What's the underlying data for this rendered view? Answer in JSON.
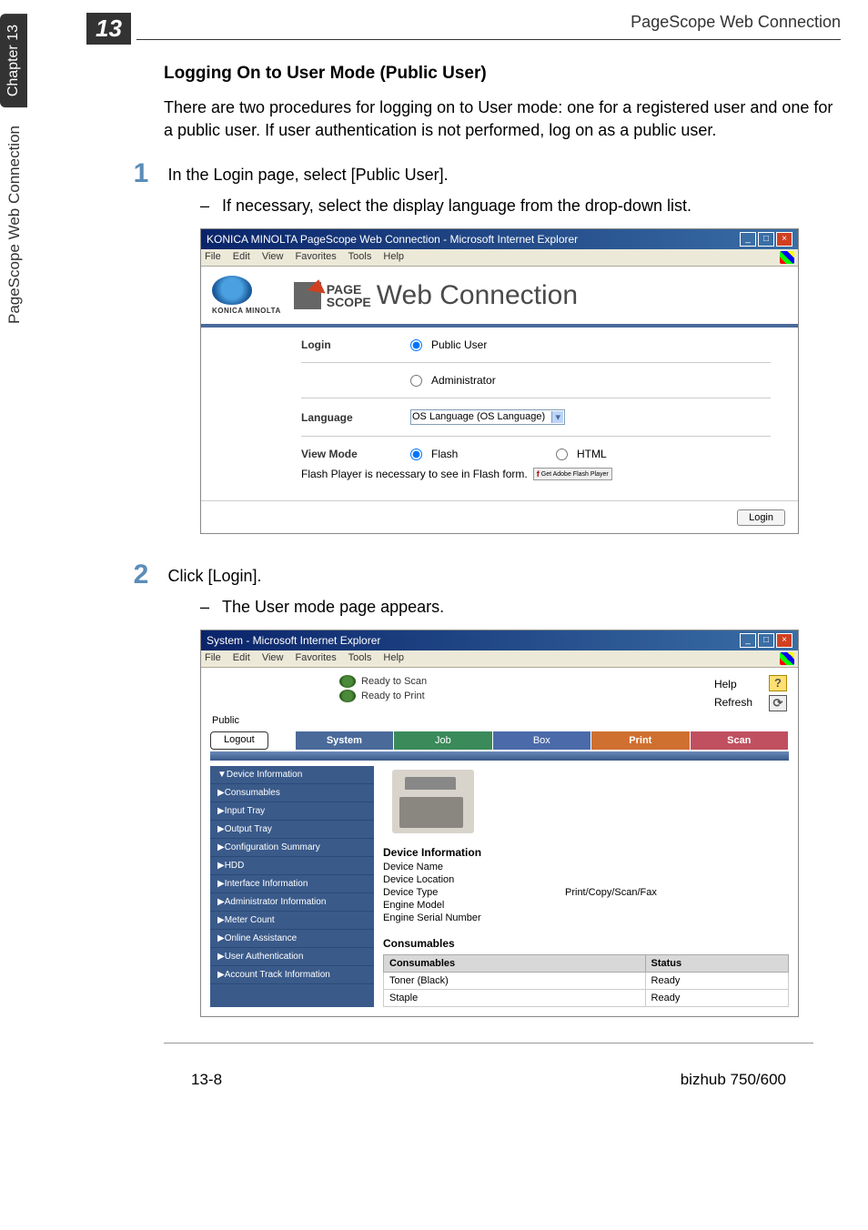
{
  "sidebar": {
    "chapter_tab": "Chapter 13",
    "side_text": "PageScope Web Connection"
  },
  "chapter_num": "13",
  "header_title": "PageScope Web Connection",
  "section_title": "Logging On to User Mode (Public User)",
  "intro_text": "There are two procedures for logging on to User mode:\none for a registered user and one for a public user. If user authentication is not performed, log on as a public user.",
  "steps": [
    {
      "num": "1",
      "text": "In the Login page, select [Public User].",
      "sub": "If necessary, select the display language from the drop-down list."
    },
    {
      "num": "2",
      "text": "Click [Login].",
      "sub": "The User mode page appears."
    }
  ],
  "login_shot": {
    "title": "KONICA MINOLTA PageScope Web Connection - Microsoft Internet Explorer",
    "menus": [
      "File",
      "Edit",
      "View",
      "Favorites",
      "Tools",
      "Help"
    ],
    "logo_brand": "KONICA MINOLTA",
    "ps_page": "PAGE",
    "ps_scope": "SCOPE",
    "ps_main": "Web Connection",
    "rows": {
      "login_label": "Login",
      "public_user": "Public User",
      "administrator": "Administrator",
      "language_label": "Language",
      "language_value": "OS Language (OS Language)",
      "viewmode_label": "View Mode",
      "flash": "Flash",
      "html": "HTML",
      "flash_note": "Flash Player is necessary to see in Flash form.",
      "flash_badge": "Get Adobe Flash Player"
    },
    "login_button": "Login"
  },
  "system_shot": {
    "title": "System - Microsoft Internet Explorer",
    "menus": [
      "File",
      "Edit",
      "View",
      "Favorites",
      "Tools",
      "Help"
    ],
    "status": {
      "scan": "Ready to Scan",
      "print": "Ready to Print"
    },
    "help": "Help",
    "refresh": "Refresh",
    "public": "Public",
    "logout": "Logout",
    "tabs": {
      "system": "System",
      "job": "Job",
      "box": "Box",
      "print": "Print",
      "scan": "Scan"
    },
    "sidemenu": [
      "▼Device Information",
      "▶Consumables",
      "▶Input Tray",
      "▶Output Tray",
      "▶Configuration Summary",
      "▶HDD",
      "▶Interface Information",
      "▶Administrator Information",
      "▶Meter Count",
      "▶Online Assistance",
      "▶User Authentication",
      "▶Account Track Information"
    ],
    "devinfo": {
      "heading": "Device Information",
      "rows": [
        "Device Name",
        "Device Location",
        "Device Type",
        "Engine Model",
        "Engine Serial Number"
      ],
      "device_type_val": "Print/Copy/Scan/Fax"
    },
    "consumables": {
      "heading": "Consumables",
      "th1": "Consumables",
      "th2": "Status",
      "rows": [
        {
          "name": "Toner (Black)",
          "status": "Ready"
        },
        {
          "name": "Staple",
          "status": "Ready"
        }
      ]
    }
  },
  "footer": {
    "left": "13-8",
    "right": "bizhub 750/600"
  }
}
